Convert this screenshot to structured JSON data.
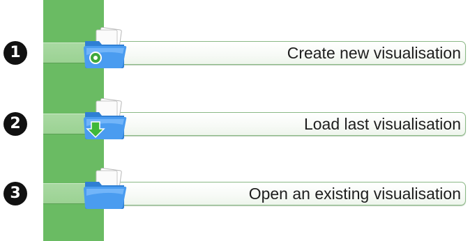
{
  "menu": {
    "items": [
      {
        "number": "1",
        "label": "Create new visualisation",
        "icon": "folder-new-icon"
      },
      {
        "number": "2",
        "label": "Load last visualisation",
        "icon": "folder-load-icon"
      },
      {
        "number": "3",
        "label": "Open an existing visualisation",
        "icon": "folder-open-icon"
      }
    ]
  },
  "colors": {
    "strip": "#6abb63",
    "folder": "#3f8fe0",
    "badge": "#111111"
  }
}
